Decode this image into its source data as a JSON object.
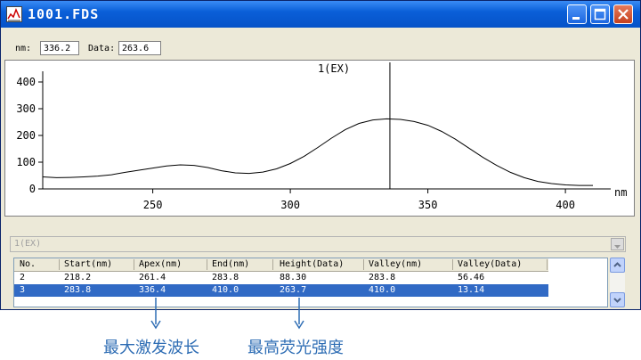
{
  "window": {
    "title": "1001.FDS",
    "colors": {
      "titlebar": "#0a5fd8",
      "selection": "#316ac5",
      "curve": "#000000"
    }
  },
  "statusbar": {
    "nm_label": "nm:",
    "nm_value": "336.2",
    "data_label": "Data:",
    "data_value": "263.6"
  },
  "chart_data": {
    "type": "line",
    "title": "1(EX)",
    "xlabel": "nm",
    "ylabel": "",
    "xlim": [
      210,
      410
    ],
    "ylim": [
      0,
      420
    ],
    "x_ticks": [
      250,
      300,
      350,
      400
    ],
    "y_ticks": [
      0,
      100,
      200,
      300,
      400
    ],
    "cursor_x": 336.2,
    "grid": false,
    "series": [
      {
        "x": [
          210,
          215,
          220,
          225,
          230,
          235,
          240,
          245,
          250,
          255,
          260,
          265,
          270,
          275,
          280,
          285,
          290,
          295,
          300,
          305,
          310,
          315,
          320,
          325,
          330,
          335,
          340,
          345,
          350,
          355,
          360,
          365,
          370,
          375,
          380,
          385,
          390,
          395,
          400,
          405,
          410
        ],
        "y": [
          45,
          42,
          43,
          45,
          48,
          53,
          62,
          70,
          78,
          86,
          90,
          88,
          80,
          68,
          60,
          58,
          63,
          75,
          95,
          122,
          155,
          190,
          222,
          245,
          258,
          262,
          260,
          252,
          238,
          215,
          186,
          152,
          118,
          88,
          62,
          42,
          28,
          20,
          15,
          13,
          13
        ]
      }
    ]
  },
  "peak_table": {
    "combo_text": "1(EX)",
    "columns": [
      "No.",
      "Start(nm)",
      "Apex(nm)",
      "End(nm)",
      "Height(Data)",
      "Valley(nm)",
      "Valley(Data)"
    ],
    "rows": [
      [
        "2",
        "218.2",
        "261.4",
        "283.8",
        "88.30",
        "283.8",
        "56.46"
      ],
      [
        "3",
        "283.8",
        "336.4",
        "410.0",
        "263.7",
        "410.0",
        "13.14"
      ]
    ],
    "selected_row": 1
  },
  "annotations": {
    "apex_note": "最大激发波长",
    "height_note": "最高荧光强度"
  }
}
